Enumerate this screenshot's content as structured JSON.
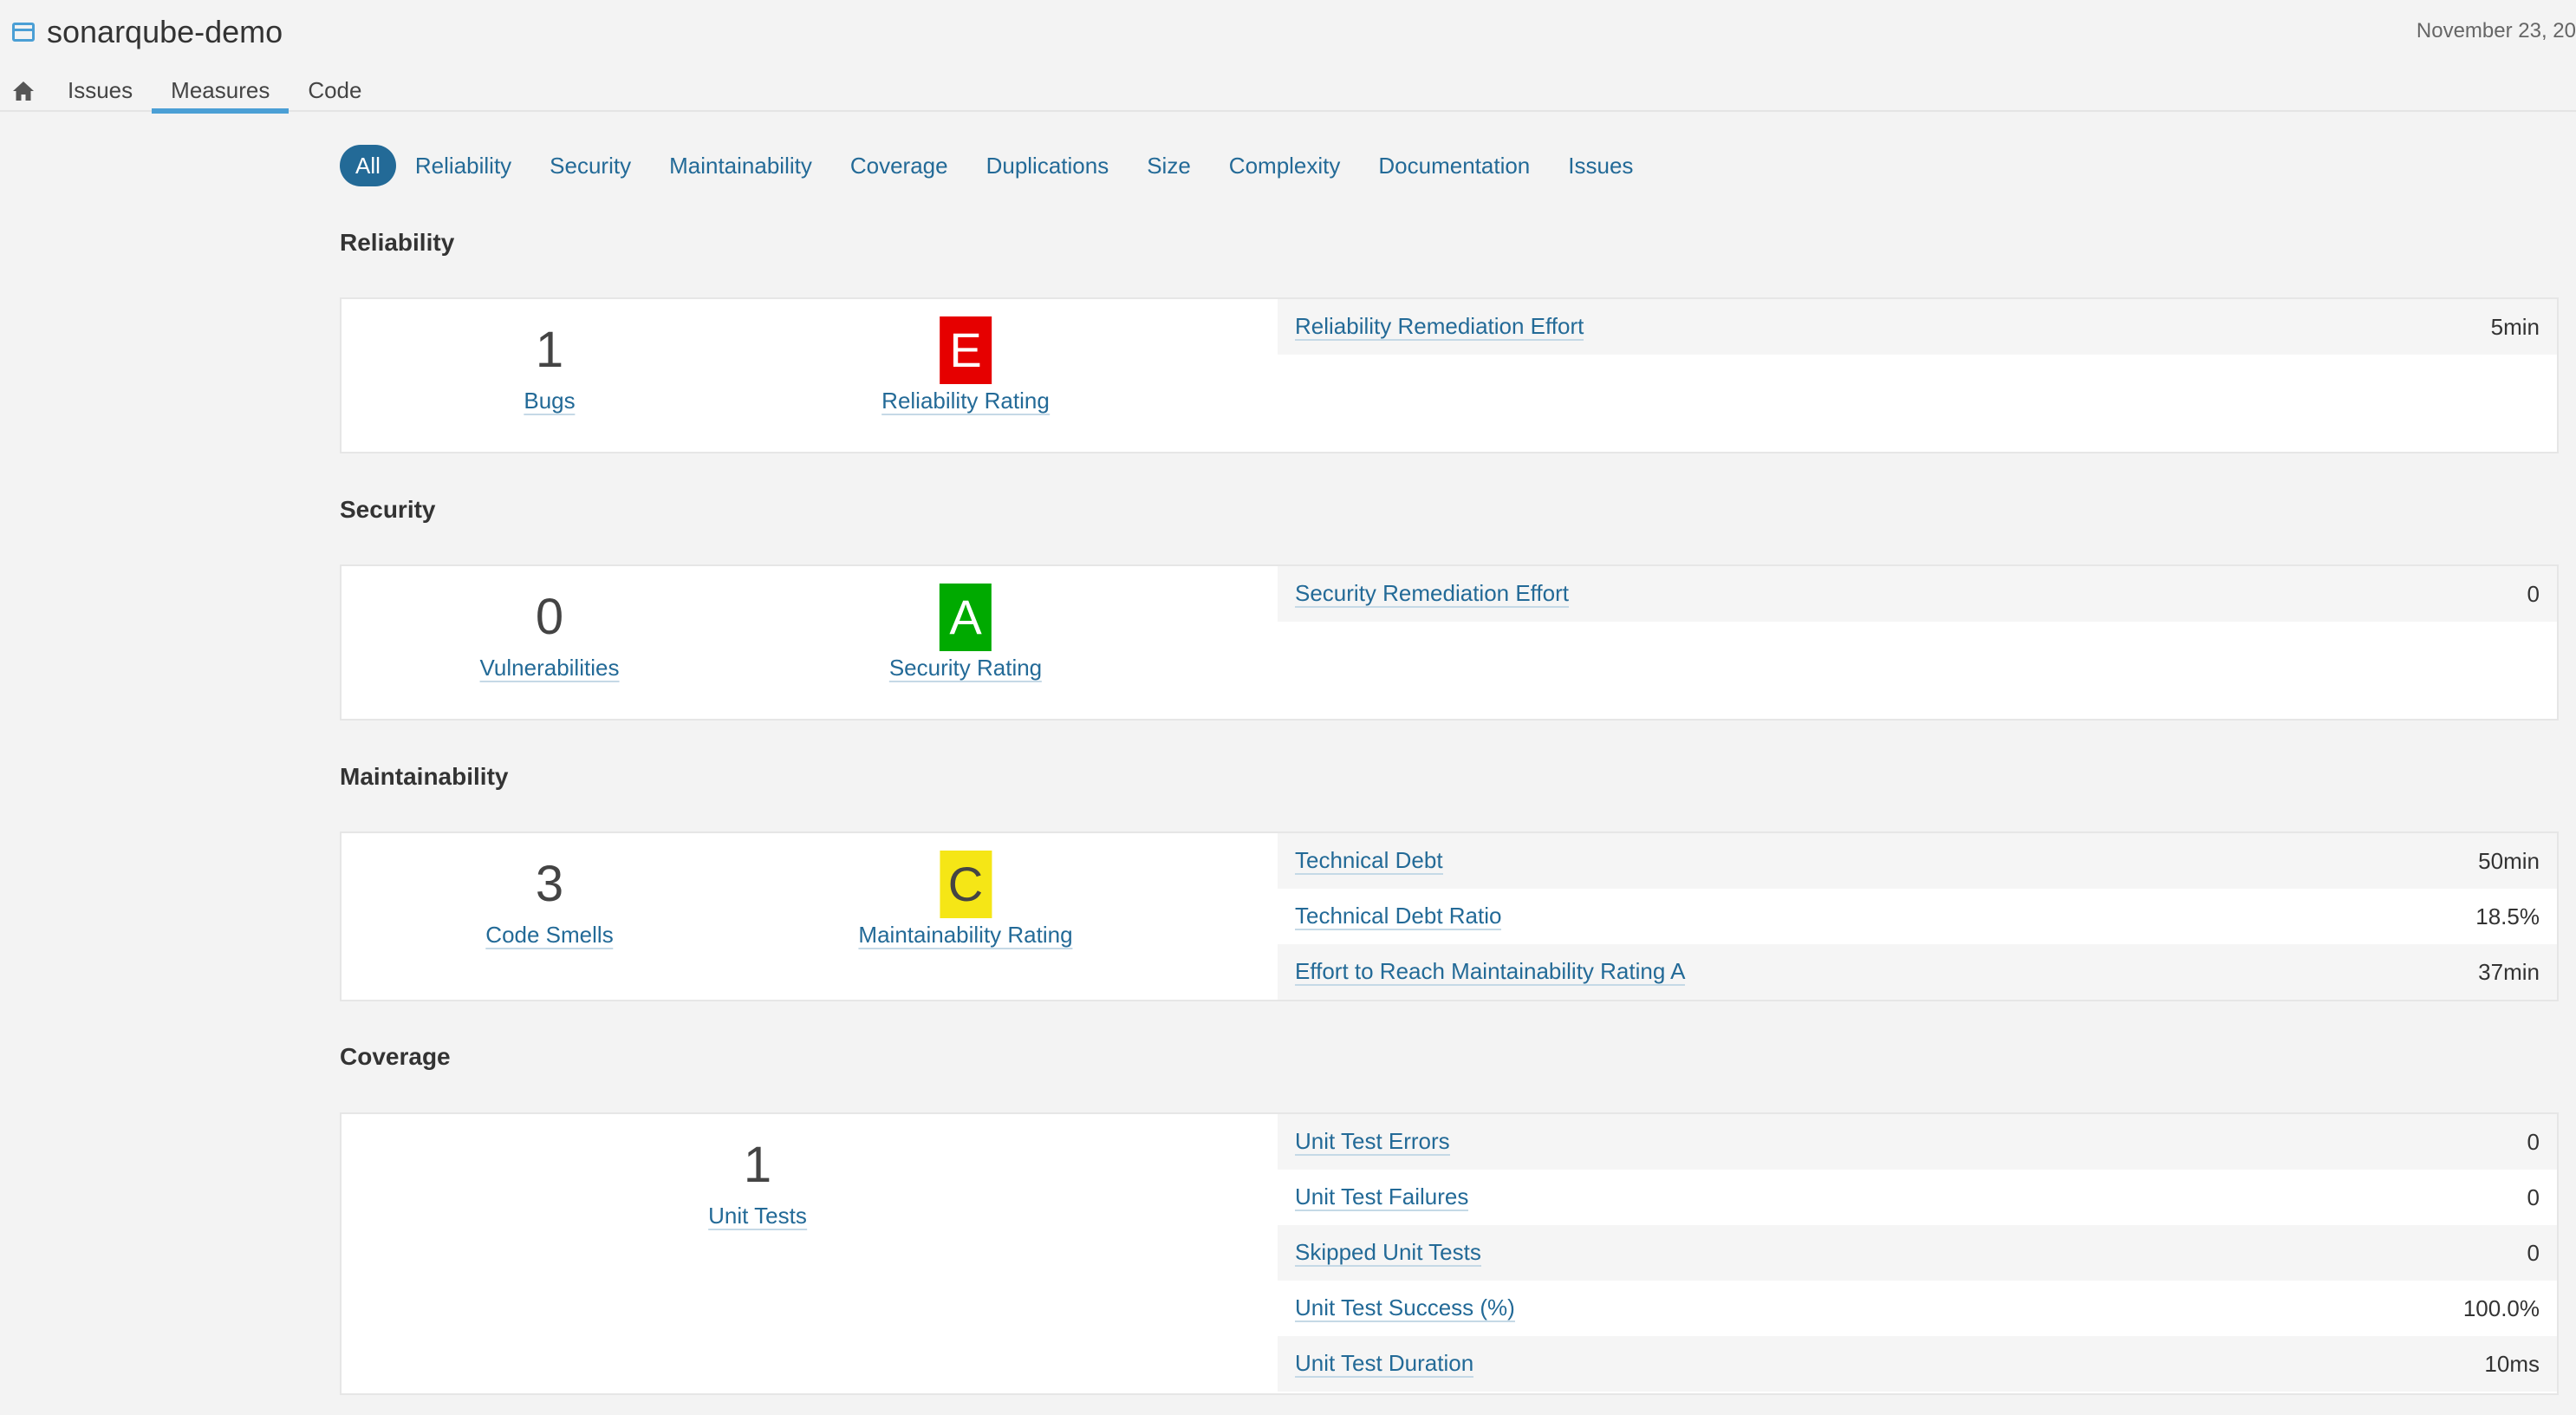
{
  "header": {
    "project_name": "sonarqube-demo",
    "date": "November 23, 20",
    "nav": [
      {
        "label": "Issues"
      },
      {
        "label": "Measures",
        "active": true
      },
      {
        "label": "Code"
      }
    ]
  },
  "filters": [
    "All",
    "Reliability",
    "Security",
    "Maintainability",
    "Coverage",
    "Duplications",
    "Size",
    "Complexity",
    "Documentation",
    "Issues"
  ],
  "sections": {
    "reliability": {
      "title": "Reliability",
      "count_value": "1",
      "count_label": "Bugs",
      "rating_value": "E",
      "rating_label": "Reliability Rating",
      "rows": [
        {
          "label": "Reliability Remediation Effort",
          "value": "5min"
        }
      ]
    },
    "security": {
      "title": "Security",
      "count_value": "0",
      "count_label": "Vulnerabilities",
      "rating_value": "A",
      "rating_label": "Security Rating",
      "rows": [
        {
          "label": "Security Remediation Effort",
          "value": "0"
        }
      ]
    },
    "maintainability": {
      "title": "Maintainability",
      "count_value": "3",
      "count_label": "Code Smells",
      "rating_value": "C",
      "rating_label": "Maintainability Rating",
      "rows": [
        {
          "label": "Technical Debt",
          "value": "50min"
        },
        {
          "label": "Technical Debt Ratio",
          "value": "18.5%"
        },
        {
          "label": "Effort to Reach Maintainability Rating A",
          "value": "37min"
        }
      ]
    },
    "coverage": {
      "title": "Coverage",
      "count_value": "1",
      "count_label": "Unit Tests",
      "rows": [
        {
          "label": "Unit Test Errors",
          "value": "0"
        },
        {
          "label": "Unit Test Failures",
          "value": "0"
        },
        {
          "label": "Skipped Unit Tests",
          "value": "0"
        },
        {
          "label": "Unit Test Success (%)",
          "value": "100.0%"
        },
        {
          "label": "Unit Test Duration",
          "value": "10ms"
        }
      ]
    }
  },
  "colors": {
    "accent": "#236a97",
    "rating_e": "#e60000",
    "rating_a": "#00aa00",
    "rating_c": "#f5e616"
  },
  "icons": {
    "project": "project-icon",
    "home": "home-icon"
  }
}
